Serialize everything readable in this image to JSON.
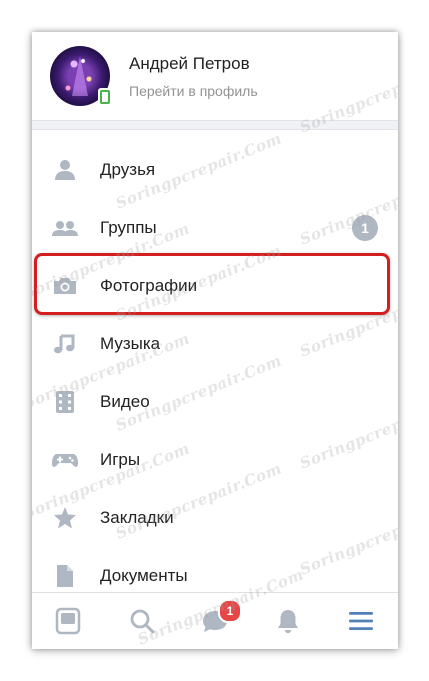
{
  "profile": {
    "name": "Андрей Петров",
    "link": "Перейти в профиль"
  },
  "menu": {
    "items": [
      {
        "label": "Друзья",
        "icon": "person-icon"
      },
      {
        "label": "Группы",
        "icon": "people-icon",
        "badge": "1"
      },
      {
        "label": "Фотографии",
        "icon": "camera-icon",
        "highlighted": true
      },
      {
        "label": "Музыка",
        "icon": "music-note-icon"
      },
      {
        "label": "Видео",
        "icon": "film-icon"
      },
      {
        "label": "Игры",
        "icon": "gamepad-icon"
      },
      {
        "label": "Закладки",
        "icon": "star-icon"
      },
      {
        "label": "Документы",
        "icon": "document-icon"
      }
    ]
  },
  "tabbar": {
    "tabs": [
      {
        "icon": "news-icon"
      },
      {
        "icon": "search-icon"
      },
      {
        "icon": "messages-icon",
        "badge": "1"
      },
      {
        "icon": "notifications-bell-icon"
      },
      {
        "icon": "menu-icon",
        "active": true
      }
    ]
  },
  "watermark": "Soringpcrepair.Com",
  "colors": {
    "text": "#222222",
    "secondary_text": "#939393",
    "icon_gray": "#aeb7c2",
    "accent_blue": "#5181b8",
    "badge_red": "#e64646",
    "highlight_red": "#d31f1f",
    "online_green": "#4bb34b"
  }
}
